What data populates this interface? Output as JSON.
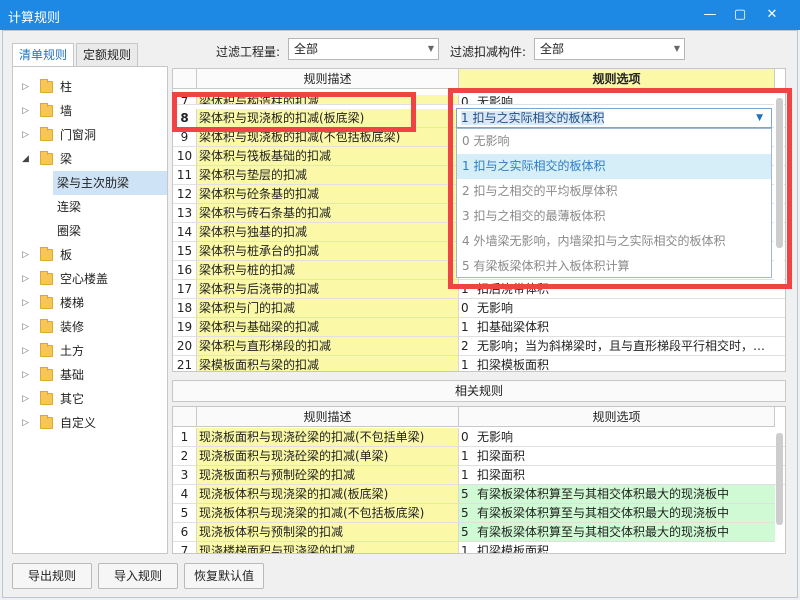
{
  "window": {
    "title": "计算规则",
    "min_icon": "minimize-icon",
    "max_icon": "maximize-icon",
    "close_icon": "close-icon"
  },
  "tabs": [
    "清单规则",
    "定额规则"
  ],
  "tree": [
    {
      "label": "柱",
      "expanded": false
    },
    {
      "label": "墙",
      "expanded": false
    },
    {
      "label": "门窗洞",
      "expanded": false
    },
    {
      "label": "梁",
      "expanded": true,
      "children": [
        "梁与主次肋梁",
        "连梁",
        "圈梁"
      ]
    },
    {
      "label": "板",
      "expanded": false
    },
    {
      "label": "空心楼盖",
      "expanded": false
    },
    {
      "label": "楼梯",
      "expanded": false
    },
    {
      "label": "装修",
      "expanded": false
    },
    {
      "label": "土方",
      "expanded": false
    },
    {
      "label": "基础",
      "expanded": false
    },
    {
      "label": "其它",
      "expanded": false
    },
    {
      "label": "自定义",
      "expanded": false
    }
  ],
  "filters": {
    "project_label": "过滤工程量:",
    "project_value": "全部",
    "component_label": "过滤扣减构件:",
    "component_value": "全部"
  },
  "main_table": {
    "headers": [
      "规则描述",
      "规则选项"
    ],
    "rows": [
      {
        "no": "7",
        "desc": "梁体积与构造柱的扣减",
        "opt_num": "0",
        "opt": "无影响",
        "partial": true
      },
      {
        "no": "8",
        "desc": "梁体积与现浇板的扣减(板底梁)",
        "opt_num": "",
        "opt": ""
      },
      {
        "no": "9",
        "desc": "梁体积与现浇板的扣减(不包括板底梁)",
        "opt_num": "",
        "opt": ""
      },
      {
        "no": "10",
        "desc": "梁体积与筏板基础的扣减",
        "opt_num": "",
        "opt": ""
      },
      {
        "no": "11",
        "desc": "梁体积与垫层的扣减",
        "opt_num": "",
        "opt": ""
      },
      {
        "no": "12",
        "desc": "梁体积与砼条基的扣减",
        "opt_num": "",
        "opt": ""
      },
      {
        "no": "13",
        "desc": "梁体积与砖石条基的扣减",
        "opt_num": "",
        "opt": ""
      },
      {
        "no": "14",
        "desc": "梁体积与独基的扣减",
        "opt_num": "",
        "opt": ""
      },
      {
        "no": "15",
        "desc": "梁体积与桩承台的扣减",
        "opt_num": "",
        "opt": ""
      },
      {
        "no": "16",
        "desc": "梁体积与桩的扣减",
        "opt_num": "",
        "opt": ""
      },
      {
        "no": "17",
        "desc": "梁体积与后浇带的扣减",
        "opt_num": "1",
        "opt": "扣后浇带体积"
      },
      {
        "no": "18",
        "desc": "梁体积与门的扣减",
        "opt_num": "0",
        "opt": "无影响"
      },
      {
        "no": "19",
        "desc": "梁体积与基础梁的扣减",
        "opt_num": "1",
        "opt": "扣基础梁体积"
      },
      {
        "no": "20",
        "desc": "梁体积与直形梯段的扣减",
        "opt_num": "2",
        "opt": "无影响；当为斜梯梁时，且与直形梯段平行相交时，…"
      },
      {
        "no": "21",
        "desc": "梁模板面积与梁的扣减",
        "opt_num": "1",
        "opt": "扣梁模板面积"
      }
    ]
  },
  "dropdown": {
    "current": "1 扣与之实际相交的板体积",
    "options": [
      "0  无影响",
      "1  扣与之实际相交的板体积",
      "2  扣与之相交的平均板厚体积",
      "3  扣与之相交的最薄板体积",
      "4  外墙梁无影响，内墙梁扣与之实际相交的板体积",
      "5  有梁板梁体积并入板体积计算"
    ],
    "highlighted_index": 1
  },
  "related": {
    "title": "相关规则",
    "headers": [
      "规则描述",
      "规则选项"
    ],
    "rows": [
      {
        "no": "1",
        "desc": "现浇板面积与现浇砼梁的扣减(不包括单梁)",
        "opt_num": "0",
        "opt": "无影响",
        "green": false
      },
      {
        "no": "2",
        "desc": "现浇板面积与现浇砼梁的扣减(单梁)",
        "opt_num": "1",
        "opt": "扣梁面积",
        "green": false
      },
      {
        "no": "3",
        "desc": "现浇板面积与预制砼梁的扣减",
        "opt_num": "1",
        "opt": "扣梁面积",
        "green": false
      },
      {
        "no": "4",
        "desc": "现浇板体积与现浇梁的扣减(板底梁)",
        "opt_num": "5",
        "opt": "有梁板梁体积算至与其相交体积最大的现浇板中",
        "green": true
      },
      {
        "no": "5",
        "desc": "现浇板体积与现浇梁的扣减(不包括板底梁)",
        "opt_num": "5",
        "opt": "有梁板梁体积算至与其相交体积最大的现浇板中",
        "green": true
      },
      {
        "no": "6",
        "desc": "现浇板体积与预制梁的扣减",
        "opt_num": "5",
        "opt": "有梁板梁体积算至与其相交体积最大的现浇板中",
        "green": true
      },
      {
        "no": "7",
        "desc": "现浇楼梯面积与现浇梁的扣减",
        "opt_num": "1",
        "opt": "扣梁模板面积",
        "green": false
      }
    ]
  },
  "buttons": {
    "export": "导出规则",
    "import": "导入规则",
    "restore": "恢复默认值"
  },
  "colors": {
    "titlebar": "#1e88e5",
    "highlight_red": "#f04444",
    "desc_yellow": "#fbf9a8",
    "opt_green": "#cffad3"
  }
}
